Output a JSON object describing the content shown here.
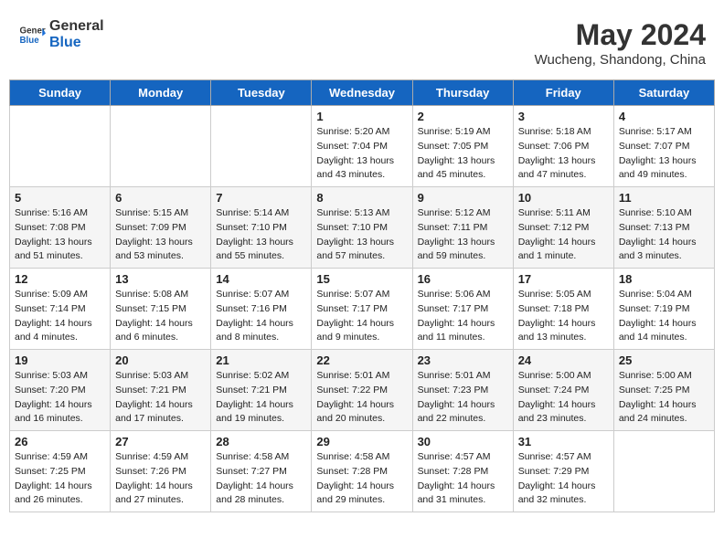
{
  "header": {
    "logo_line1": "General",
    "logo_line2": "Blue",
    "month_year": "May 2024",
    "location": "Wucheng, Shandong, China"
  },
  "days_of_week": [
    "Sunday",
    "Monday",
    "Tuesday",
    "Wednesday",
    "Thursday",
    "Friday",
    "Saturday"
  ],
  "weeks": [
    [
      {
        "day": "",
        "info": ""
      },
      {
        "day": "",
        "info": ""
      },
      {
        "day": "",
        "info": ""
      },
      {
        "day": "1",
        "info": "Sunrise: 5:20 AM\nSunset: 7:04 PM\nDaylight: 13 hours\nand 43 minutes."
      },
      {
        "day": "2",
        "info": "Sunrise: 5:19 AM\nSunset: 7:05 PM\nDaylight: 13 hours\nand 45 minutes."
      },
      {
        "day": "3",
        "info": "Sunrise: 5:18 AM\nSunset: 7:06 PM\nDaylight: 13 hours\nand 47 minutes."
      },
      {
        "day": "4",
        "info": "Sunrise: 5:17 AM\nSunset: 7:07 PM\nDaylight: 13 hours\nand 49 minutes."
      }
    ],
    [
      {
        "day": "5",
        "info": "Sunrise: 5:16 AM\nSunset: 7:08 PM\nDaylight: 13 hours\nand 51 minutes."
      },
      {
        "day": "6",
        "info": "Sunrise: 5:15 AM\nSunset: 7:09 PM\nDaylight: 13 hours\nand 53 minutes."
      },
      {
        "day": "7",
        "info": "Sunrise: 5:14 AM\nSunset: 7:10 PM\nDaylight: 13 hours\nand 55 minutes."
      },
      {
        "day": "8",
        "info": "Sunrise: 5:13 AM\nSunset: 7:10 PM\nDaylight: 13 hours\nand 57 minutes."
      },
      {
        "day": "9",
        "info": "Sunrise: 5:12 AM\nSunset: 7:11 PM\nDaylight: 13 hours\nand 59 minutes."
      },
      {
        "day": "10",
        "info": "Sunrise: 5:11 AM\nSunset: 7:12 PM\nDaylight: 14 hours\nand 1 minute."
      },
      {
        "day": "11",
        "info": "Sunrise: 5:10 AM\nSunset: 7:13 PM\nDaylight: 14 hours\nand 3 minutes."
      }
    ],
    [
      {
        "day": "12",
        "info": "Sunrise: 5:09 AM\nSunset: 7:14 PM\nDaylight: 14 hours\nand 4 minutes."
      },
      {
        "day": "13",
        "info": "Sunrise: 5:08 AM\nSunset: 7:15 PM\nDaylight: 14 hours\nand 6 minutes."
      },
      {
        "day": "14",
        "info": "Sunrise: 5:07 AM\nSunset: 7:16 PM\nDaylight: 14 hours\nand 8 minutes."
      },
      {
        "day": "15",
        "info": "Sunrise: 5:07 AM\nSunset: 7:17 PM\nDaylight: 14 hours\nand 9 minutes."
      },
      {
        "day": "16",
        "info": "Sunrise: 5:06 AM\nSunset: 7:17 PM\nDaylight: 14 hours\nand 11 minutes."
      },
      {
        "day": "17",
        "info": "Sunrise: 5:05 AM\nSunset: 7:18 PM\nDaylight: 14 hours\nand 13 minutes."
      },
      {
        "day": "18",
        "info": "Sunrise: 5:04 AM\nSunset: 7:19 PM\nDaylight: 14 hours\nand 14 minutes."
      }
    ],
    [
      {
        "day": "19",
        "info": "Sunrise: 5:03 AM\nSunset: 7:20 PM\nDaylight: 14 hours\nand 16 minutes."
      },
      {
        "day": "20",
        "info": "Sunrise: 5:03 AM\nSunset: 7:21 PM\nDaylight: 14 hours\nand 17 minutes."
      },
      {
        "day": "21",
        "info": "Sunrise: 5:02 AM\nSunset: 7:21 PM\nDaylight: 14 hours\nand 19 minutes."
      },
      {
        "day": "22",
        "info": "Sunrise: 5:01 AM\nSunset: 7:22 PM\nDaylight: 14 hours\nand 20 minutes."
      },
      {
        "day": "23",
        "info": "Sunrise: 5:01 AM\nSunset: 7:23 PM\nDaylight: 14 hours\nand 22 minutes."
      },
      {
        "day": "24",
        "info": "Sunrise: 5:00 AM\nSunset: 7:24 PM\nDaylight: 14 hours\nand 23 minutes."
      },
      {
        "day": "25",
        "info": "Sunrise: 5:00 AM\nSunset: 7:25 PM\nDaylight: 14 hours\nand 24 minutes."
      }
    ],
    [
      {
        "day": "26",
        "info": "Sunrise: 4:59 AM\nSunset: 7:25 PM\nDaylight: 14 hours\nand 26 minutes."
      },
      {
        "day": "27",
        "info": "Sunrise: 4:59 AM\nSunset: 7:26 PM\nDaylight: 14 hours\nand 27 minutes."
      },
      {
        "day": "28",
        "info": "Sunrise: 4:58 AM\nSunset: 7:27 PM\nDaylight: 14 hours\nand 28 minutes."
      },
      {
        "day": "29",
        "info": "Sunrise: 4:58 AM\nSunset: 7:28 PM\nDaylight: 14 hours\nand 29 minutes."
      },
      {
        "day": "30",
        "info": "Sunrise: 4:57 AM\nSunset: 7:28 PM\nDaylight: 14 hours\nand 31 minutes."
      },
      {
        "day": "31",
        "info": "Sunrise: 4:57 AM\nSunset: 7:29 PM\nDaylight: 14 hours\nand 32 minutes."
      },
      {
        "day": "",
        "info": ""
      }
    ]
  ]
}
